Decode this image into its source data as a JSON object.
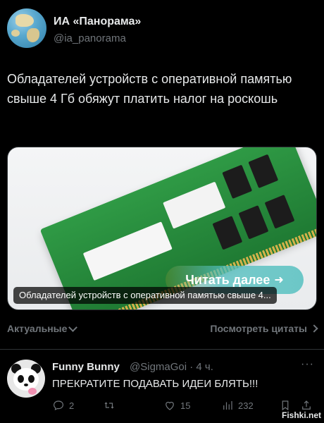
{
  "author": {
    "display_name": "ИА «Панорама»",
    "handle": "@ia_panorama",
    "avatar": "globe-avatar"
  },
  "tweet": {
    "text": "Обладателей устройств с оперативной памятью свыше 4 Гб обяжут платить налог на роскошь"
  },
  "card": {
    "cta_label": "Читать далее",
    "cta_arrow": "➜",
    "caption": "Обладателей устройств с оперативной памятью свыше 4..."
  },
  "meta": {
    "relevant_label": "Актуальные",
    "view_quotes_label": "Посмотреть цитаты"
  },
  "reply": {
    "name": "Funny Bunny",
    "handle_time": "@SigmaGoi · 4 ч.",
    "more": "···",
    "text": "ПРЕКРАТИТЕ ПОДАВАТЬ ИДЕИ БЛЯТЬ!!!",
    "replies": "2",
    "retweets": "",
    "likes": "15",
    "views": "232"
  },
  "watermark": "Fishki.net",
  "colors": {
    "background": "#000000",
    "text": "#e7e9ea",
    "muted": "#71767b",
    "divider": "#2f3336",
    "cta": "#6cc7c7"
  }
}
